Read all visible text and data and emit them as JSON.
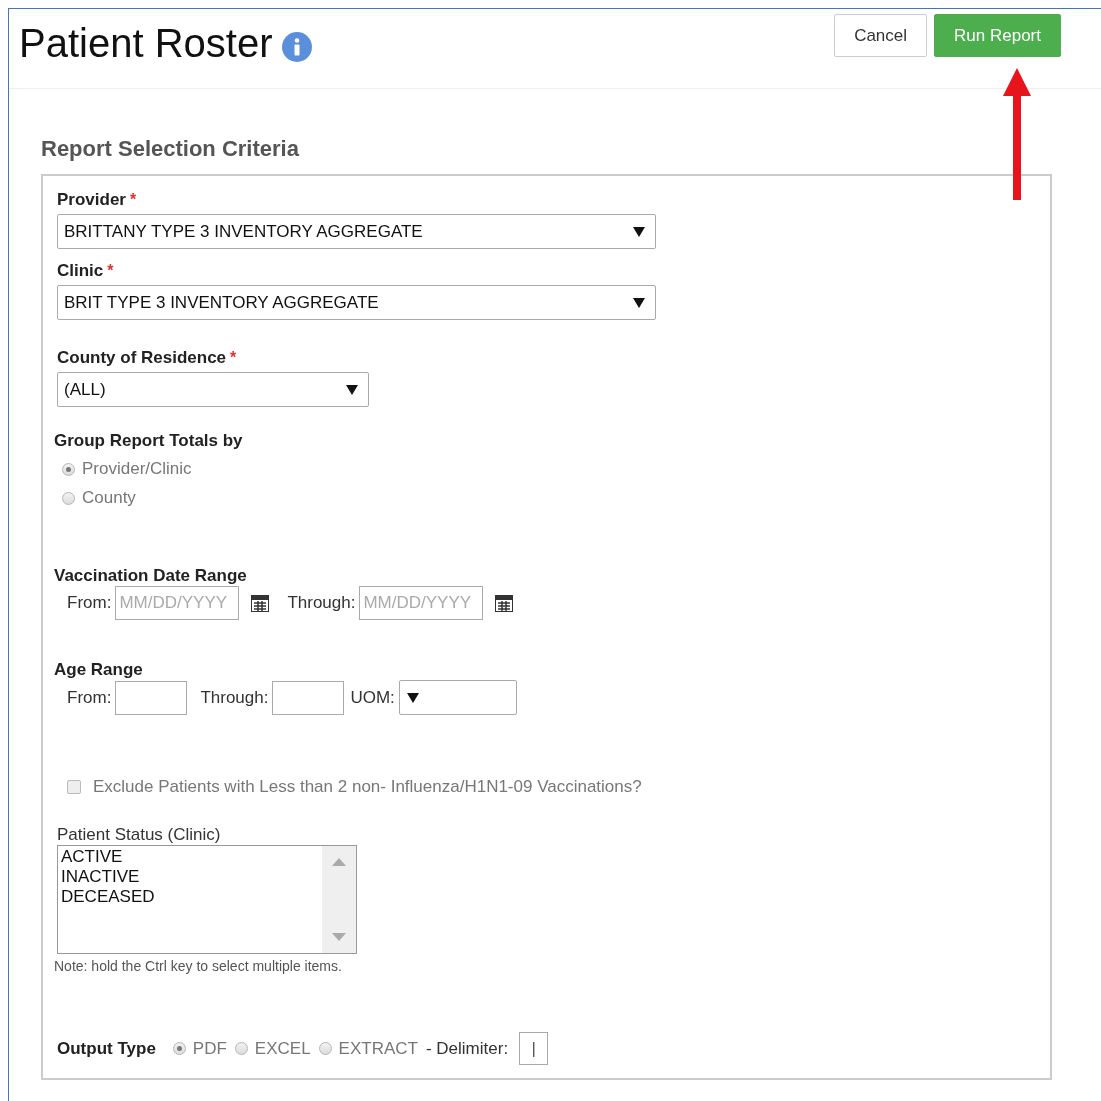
{
  "header": {
    "title": "Patient Roster",
    "buttons": [
      {
        "label": "Cancel",
        "kind": "default"
      },
      {
        "label": "Run Report",
        "kind": "primary"
      }
    ]
  },
  "section_title": "Report Selection Criteria",
  "provider": {
    "label": "Provider",
    "required_mark": "*",
    "value": "BRITTANY TYPE 3 INVENTORY AGGREGATE"
  },
  "clinic": {
    "label": "Clinic",
    "required_mark": "*",
    "value": "BRIT TYPE 3 INVENTORY AGGREGATE"
  },
  "county": {
    "label": "County of Residence",
    "required_mark": "*",
    "value": "(ALL)"
  },
  "group_totals": {
    "label": "Group Report Totals by",
    "options": [
      {
        "label": "Provider/Clinic",
        "selected": true
      },
      {
        "label": "County",
        "selected": false
      }
    ]
  },
  "vaccination_date_range": {
    "label": "Vaccination Date Range",
    "from_label": "From:",
    "from_placeholder": "MM/DD/YYYY",
    "through_label": "Through:",
    "through_placeholder": "MM/DD/YYYY"
  },
  "age_range": {
    "label": "Age Range",
    "from_label": "From:",
    "through_label": "Through:",
    "uom_label": "UOM:"
  },
  "exclude": {
    "label": "Exclude Patients with Less than 2 non- Influenza/H1N1-09 Vaccinations?",
    "checked": false
  },
  "patient_status": {
    "label": "Patient Status (Clinic)",
    "items": [
      "ACTIVE",
      "INACTIVE",
      "DECEASED"
    ],
    "note": "Note: hold the Ctrl key to select multiple items."
  },
  "output_type": {
    "label": "Output Type",
    "options": [
      {
        "label": "PDF",
        "selected": true
      },
      {
        "label": "EXCEL",
        "selected": false
      },
      {
        "label": "EXTRACT",
        "selected": false
      }
    ],
    "delimiter_label": "- Delimiter:",
    "delimiter_value": "|"
  }
}
